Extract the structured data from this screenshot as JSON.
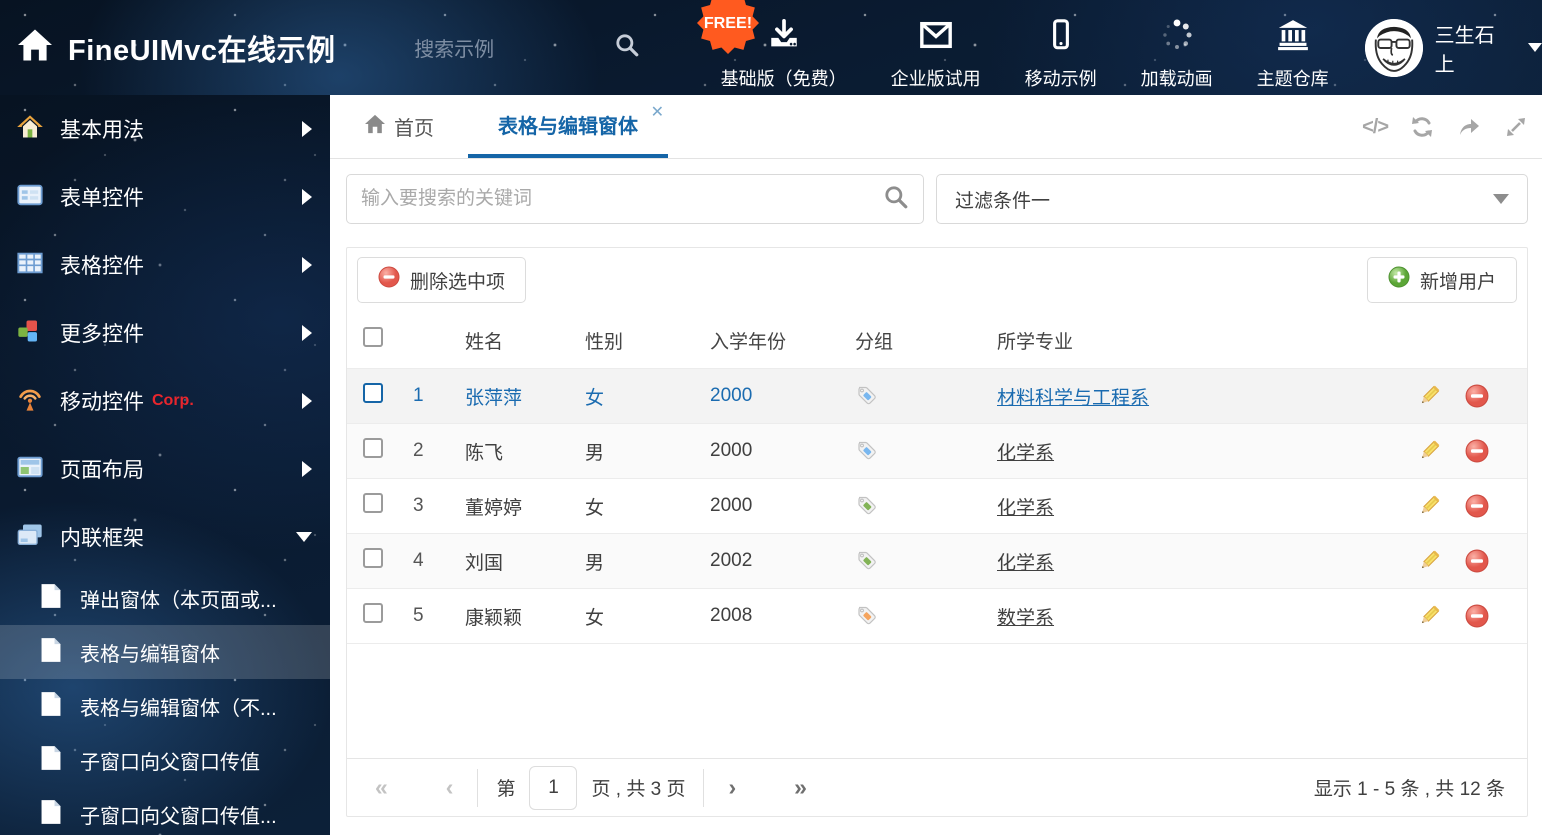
{
  "header": {
    "title": "FineUIMvc在线示例",
    "search_placeholder": "搜索示例",
    "free_badge": "FREE!",
    "nav_items": [
      {
        "label": "基础版（免费）",
        "icon": "download-icon"
      },
      {
        "label": "企业版试用",
        "icon": "envelope-icon"
      },
      {
        "label": "移动示例",
        "icon": "mobile-icon"
      },
      {
        "label": "加载动画",
        "icon": "spinner-icon"
      },
      {
        "label": "主题仓库",
        "icon": "bank-icon"
      }
    ],
    "user": {
      "name": "三生石上"
    }
  },
  "sidebar": {
    "items": [
      {
        "label": "基本用法",
        "icon": "home-icon"
      },
      {
        "label": "表单控件",
        "icon": "form-icon"
      },
      {
        "label": "表格控件",
        "icon": "table-icon"
      },
      {
        "label": "更多控件",
        "icon": "cubes-icon"
      },
      {
        "label": "移动控件",
        "badge": "Corp.",
        "icon": "antenna-icon"
      },
      {
        "label": "页面布局",
        "icon": "layout-icon"
      },
      {
        "label": "内联框架",
        "icon": "frames-icon",
        "expanded": true
      }
    ],
    "subitems": [
      {
        "label": "弹出窗体（本页面或..."
      },
      {
        "label": "表格与编辑窗体",
        "active": true
      },
      {
        "label": "表格与编辑窗体（不..."
      },
      {
        "label": "子窗口向父窗口传值"
      },
      {
        "label": "子窗口向父窗口传值..."
      }
    ]
  },
  "tabs": [
    {
      "label": "首页",
      "icon": "home-icon"
    },
    {
      "label": "表格与编辑窗体",
      "active": true,
      "close": "✕"
    }
  ],
  "filters": {
    "search_placeholder": "输入要搜索的关键词",
    "filter_selected": "过滤条件一"
  },
  "toolbar": {
    "delete_label": "删除选中项",
    "add_label": "新增用户"
  },
  "table": {
    "headers": {
      "name": "姓名",
      "gender": "性别",
      "year": "入学年份",
      "group": "分组",
      "major": "所学专业"
    },
    "rows": [
      {
        "index": "1",
        "name": "张萍萍",
        "gender": "女",
        "year": "2000",
        "tag_color": "#79b7ef",
        "major": "材料科学与工程系",
        "selected": true
      },
      {
        "index": "2",
        "name": "陈飞",
        "gender": "男",
        "year": "2000",
        "tag_color": "#79b7ef",
        "major": "化学系"
      },
      {
        "index": "3",
        "name": "董婷婷",
        "gender": "女",
        "year": "2000",
        "tag_color": "#82b356",
        "major": "化学系"
      },
      {
        "index": "4",
        "name": "刘国",
        "gender": "男",
        "year": "2002",
        "tag_color": "#82b356",
        "major": "化学系"
      },
      {
        "index": "5",
        "name": "康颖颖",
        "gender": "女",
        "year": "2008",
        "tag_color": "#f5a45d",
        "major": "数学系"
      }
    ]
  },
  "pagination": {
    "first": "«",
    "prev": "‹",
    "page_prefix": "第",
    "current_page": "1",
    "page_suffix": "页 , 共 3 页",
    "next": "›",
    "last": "»",
    "summary": "显示 1 - 5 条 , 共 12 条"
  },
  "colors": {
    "accent_blue": "#1565a7",
    "free_badge_orange": "#ff5a1f",
    "corp_red": "#e8262d",
    "delete_red": "#e2574c",
    "add_green": "#5ba636"
  }
}
